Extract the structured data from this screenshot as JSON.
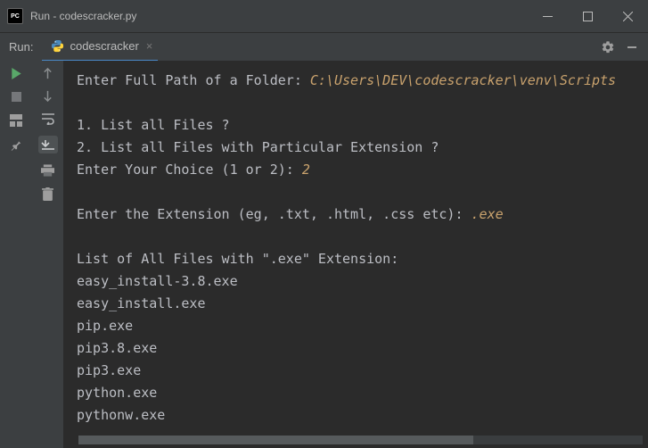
{
  "window": {
    "appIconText": "PC",
    "title": "Run - codescracker.py"
  },
  "toolbar": {
    "label": "Run:",
    "tabName": "codescracker"
  },
  "console": {
    "prompt1": "Enter Full Path of a Folder: ",
    "input1": "C:\\Users\\DEV\\codescracker\\venv\\Scripts",
    "menu1": "1. List all Files ?",
    "menu2": "2. List all Files with Particular Extension ?",
    "choicePrompt": "Enter Your Choice (1 or 2): ",
    "choice": "2",
    "extPrompt": "Enter the Extension (eg, .txt, .html, .css etc): ",
    "ext": ".exe",
    "listHeader": "List of All Files with \".exe\" Extension:",
    "files": [
      "easy_install-3.8.exe",
      "easy_install.exe",
      "pip.exe",
      "pip3.8.exe",
      "pip3.exe",
      "python.exe",
      "pythonw.exe"
    ]
  }
}
